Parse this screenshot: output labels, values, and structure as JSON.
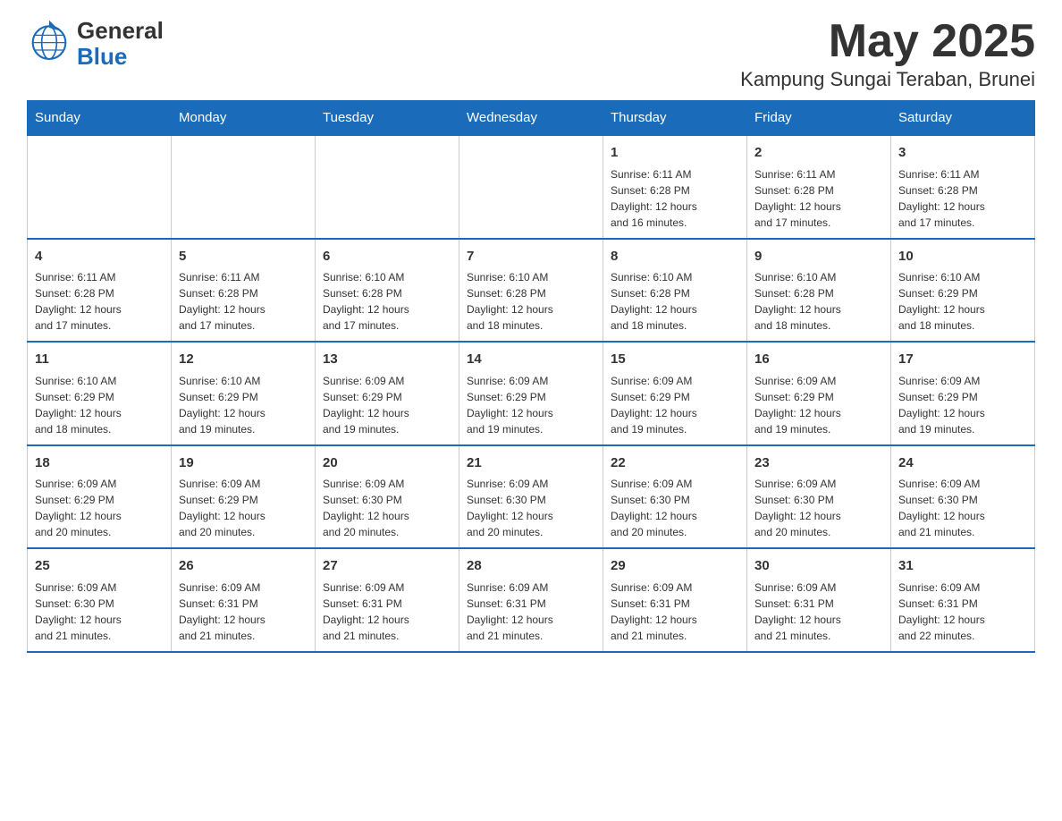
{
  "header": {
    "month_year": "May 2025",
    "location": "Kampung Sungai Teraban, Brunei",
    "logo_general": "General",
    "logo_blue": "Blue"
  },
  "days_of_week": [
    "Sunday",
    "Monday",
    "Tuesday",
    "Wednesday",
    "Thursday",
    "Friday",
    "Saturday"
  ],
  "weeks": [
    {
      "days": [
        {
          "num": "",
          "info": ""
        },
        {
          "num": "",
          "info": ""
        },
        {
          "num": "",
          "info": ""
        },
        {
          "num": "",
          "info": ""
        },
        {
          "num": "1",
          "info": "Sunrise: 6:11 AM\nSunset: 6:28 PM\nDaylight: 12 hours\nand 16 minutes."
        },
        {
          "num": "2",
          "info": "Sunrise: 6:11 AM\nSunset: 6:28 PM\nDaylight: 12 hours\nand 17 minutes."
        },
        {
          "num": "3",
          "info": "Sunrise: 6:11 AM\nSunset: 6:28 PM\nDaylight: 12 hours\nand 17 minutes."
        }
      ]
    },
    {
      "days": [
        {
          "num": "4",
          "info": "Sunrise: 6:11 AM\nSunset: 6:28 PM\nDaylight: 12 hours\nand 17 minutes."
        },
        {
          "num": "5",
          "info": "Sunrise: 6:11 AM\nSunset: 6:28 PM\nDaylight: 12 hours\nand 17 minutes."
        },
        {
          "num": "6",
          "info": "Sunrise: 6:10 AM\nSunset: 6:28 PM\nDaylight: 12 hours\nand 17 minutes."
        },
        {
          "num": "7",
          "info": "Sunrise: 6:10 AM\nSunset: 6:28 PM\nDaylight: 12 hours\nand 18 minutes."
        },
        {
          "num": "8",
          "info": "Sunrise: 6:10 AM\nSunset: 6:28 PM\nDaylight: 12 hours\nand 18 minutes."
        },
        {
          "num": "9",
          "info": "Sunrise: 6:10 AM\nSunset: 6:28 PM\nDaylight: 12 hours\nand 18 minutes."
        },
        {
          "num": "10",
          "info": "Sunrise: 6:10 AM\nSunset: 6:29 PM\nDaylight: 12 hours\nand 18 minutes."
        }
      ]
    },
    {
      "days": [
        {
          "num": "11",
          "info": "Sunrise: 6:10 AM\nSunset: 6:29 PM\nDaylight: 12 hours\nand 18 minutes."
        },
        {
          "num": "12",
          "info": "Sunrise: 6:10 AM\nSunset: 6:29 PM\nDaylight: 12 hours\nand 19 minutes."
        },
        {
          "num": "13",
          "info": "Sunrise: 6:09 AM\nSunset: 6:29 PM\nDaylight: 12 hours\nand 19 minutes."
        },
        {
          "num": "14",
          "info": "Sunrise: 6:09 AM\nSunset: 6:29 PM\nDaylight: 12 hours\nand 19 minutes."
        },
        {
          "num": "15",
          "info": "Sunrise: 6:09 AM\nSunset: 6:29 PM\nDaylight: 12 hours\nand 19 minutes."
        },
        {
          "num": "16",
          "info": "Sunrise: 6:09 AM\nSunset: 6:29 PM\nDaylight: 12 hours\nand 19 minutes."
        },
        {
          "num": "17",
          "info": "Sunrise: 6:09 AM\nSunset: 6:29 PM\nDaylight: 12 hours\nand 19 minutes."
        }
      ]
    },
    {
      "days": [
        {
          "num": "18",
          "info": "Sunrise: 6:09 AM\nSunset: 6:29 PM\nDaylight: 12 hours\nand 20 minutes."
        },
        {
          "num": "19",
          "info": "Sunrise: 6:09 AM\nSunset: 6:29 PM\nDaylight: 12 hours\nand 20 minutes."
        },
        {
          "num": "20",
          "info": "Sunrise: 6:09 AM\nSunset: 6:30 PM\nDaylight: 12 hours\nand 20 minutes."
        },
        {
          "num": "21",
          "info": "Sunrise: 6:09 AM\nSunset: 6:30 PM\nDaylight: 12 hours\nand 20 minutes."
        },
        {
          "num": "22",
          "info": "Sunrise: 6:09 AM\nSunset: 6:30 PM\nDaylight: 12 hours\nand 20 minutes."
        },
        {
          "num": "23",
          "info": "Sunrise: 6:09 AM\nSunset: 6:30 PM\nDaylight: 12 hours\nand 20 minutes."
        },
        {
          "num": "24",
          "info": "Sunrise: 6:09 AM\nSunset: 6:30 PM\nDaylight: 12 hours\nand 21 minutes."
        }
      ]
    },
    {
      "days": [
        {
          "num": "25",
          "info": "Sunrise: 6:09 AM\nSunset: 6:30 PM\nDaylight: 12 hours\nand 21 minutes."
        },
        {
          "num": "26",
          "info": "Sunrise: 6:09 AM\nSunset: 6:31 PM\nDaylight: 12 hours\nand 21 minutes."
        },
        {
          "num": "27",
          "info": "Sunrise: 6:09 AM\nSunset: 6:31 PM\nDaylight: 12 hours\nand 21 minutes."
        },
        {
          "num": "28",
          "info": "Sunrise: 6:09 AM\nSunset: 6:31 PM\nDaylight: 12 hours\nand 21 minutes."
        },
        {
          "num": "29",
          "info": "Sunrise: 6:09 AM\nSunset: 6:31 PM\nDaylight: 12 hours\nand 21 minutes."
        },
        {
          "num": "30",
          "info": "Sunrise: 6:09 AM\nSunset: 6:31 PM\nDaylight: 12 hours\nand 21 minutes."
        },
        {
          "num": "31",
          "info": "Sunrise: 6:09 AM\nSunset: 6:31 PM\nDaylight: 12 hours\nand 22 minutes."
        }
      ]
    }
  ]
}
